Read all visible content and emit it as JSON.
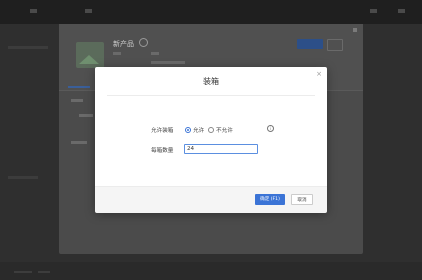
{
  "modal": {
    "title": "装箱",
    "close_symbol": "×",
    "fields": {
      "split_label": "允许装箱",
      "split_options": [
        {
          "label": "允许",
          "checked": true
        },
        {
          "label": "不允许",
          "checked": false
        }
      ],
      "qty_label": "每箱数量",
      "qty_value": "24"
    },
    "info_symbol": "i",
    "buttons": {
      "confirm": "确定 (F1)",
      "cancel": "取消"
    }
  },
  "background_dialog": {
    "title": "新产品"
  },
  "colors": {
    "primary": "#3b74d6",
    "overlay": "#2f2f2f"
  }
}
